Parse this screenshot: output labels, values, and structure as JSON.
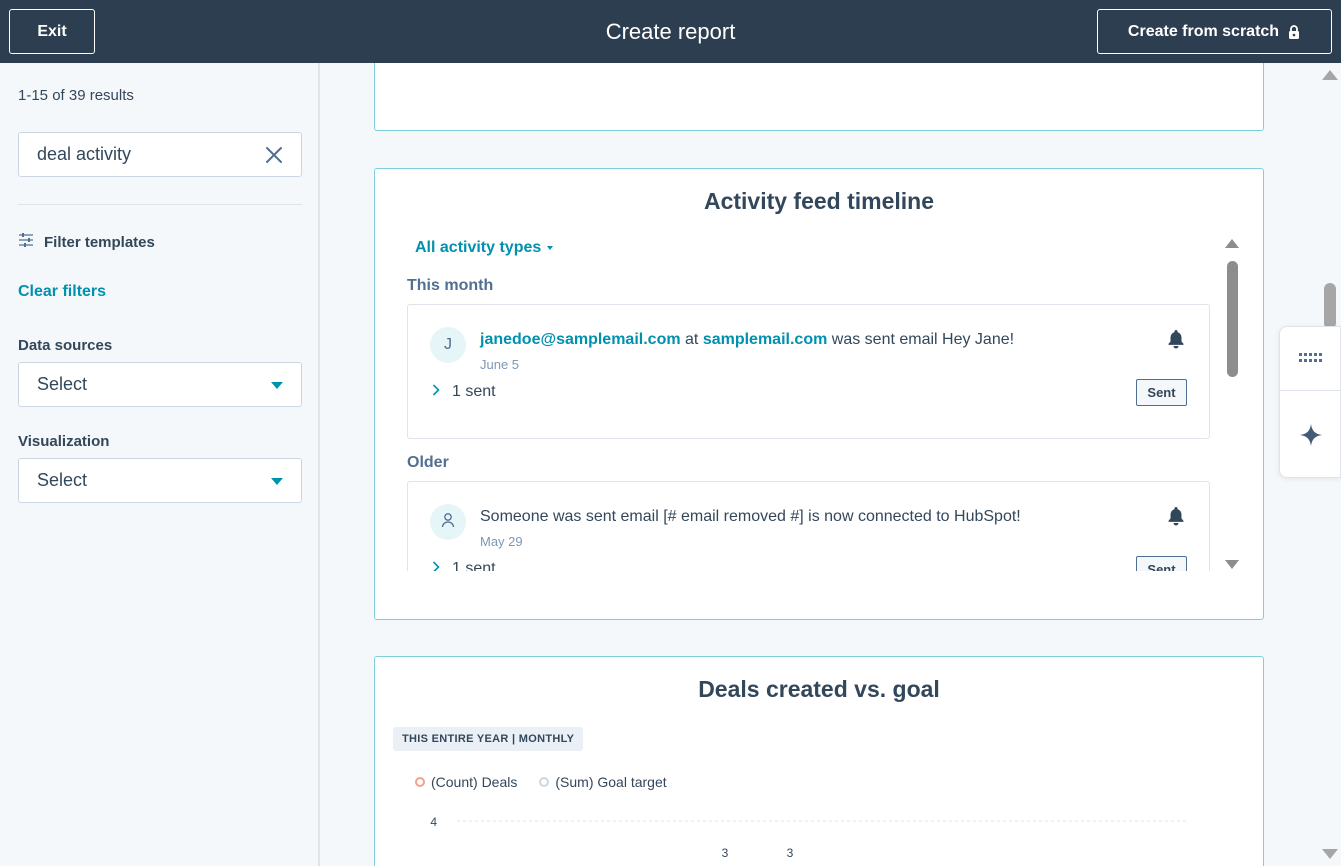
{
  "topbar": {
    "exit_label": "Exit",
    "title": "Create report",
    "scratch_label": "Create from scratch",
    "scratch_icon": "lock-icon"
  },
  "sidebar": {
    "results_text": "1-15 of 39 results",
    "search": {
      "value": "deal activity",
      "clear_icon": "close-icon"
    },
    "filter_label": "Filter templates",
    "filter_icon": "sliders-icon",
    "clear_filters_label": "Clear filters",
    "data_sources": {
      "label": "Data sources",
      "value": "Select"
    },
    "visualization": {
      "label": "Visualization",
      "value": "Select"
    }
  },
  "activity_card": {
    "title": "Activity feed timeline",
    "filter_label": "All activity types",
    "sections": [
      {
        "label": "This month",
        "item": {
          "avatar_text": "J",
          "email": "janedoe@samplemail.com",
          "at_text": "at",
          "domain": "samplemail.com",
          "action": "was sent email Hey Jane!",
          "date": "June 5",
          "expand_label": "1 sent",
          "badge": "Sent"
        }
      },
      {
        "label": "Older",
        "item": {
          "avatar_icon": "person-icon",
          "text": "Someone was sent email [# email removed #] is now connected to HubSpot!",
          "date": "May 29",
          "expand_label": "1 sent",
          "badge": "Sent"
        }
      }
    ]
  },
  "deals_card": {
    "title": "Deals created vs. goal",
    "date_chip": "THIS ENTIRE YEAR | MONTHLY",
    "legend": [
      {
        "label": "(Count) Deals",
        "color": "#f2a18e"
      },
      {
        "label": "(Sum) Goal target",
        "color": "#cbd6e2"
      }
    ]
  },
  "chart_data": {
    "type": "line",
    "y_ticks": [
      "4"
    ],
    "data_labels": [
      "3",
      "3"
    ],
    "series": [
      {
        "name": "(Count) Deals",
        "color": "#f2a18e"
      },
      {
        "name": "(Sum) Goal target",
        "color": "#cbd6e2"
      }
    ]
  },
  "colors": {
    "topbar": "#2d3e50",
    "accent": "#0091ae",
    "card_border": "#7fd1de",
    "text": "#33475b"
  }
}
